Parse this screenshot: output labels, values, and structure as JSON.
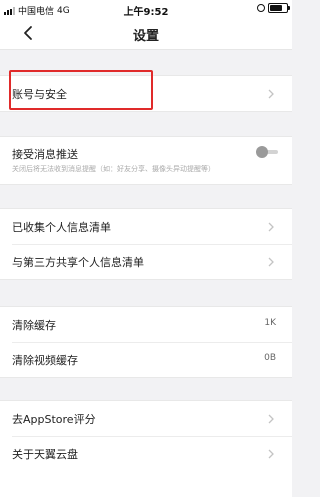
{
  "status_bar": {
    "carrier": "中国电信",
    "network": "4G",
    "time": "上午9:52",
    "battery_level": 0.85
  },
  "nav": {
    "back_icon": "chevron-left-icon",
    "title": "设置"
  },
  "sections": {
    "account": {
      "label": "账号与安全"
    },
    "push": {
      "label": "接受消息推送",
      "sublabel": "关闭后将无法收到消息提醒（如：好友分享、摄像头异动提醒等）",
      "enabled": false
    },
    "privacy": {
      "collected_label": "已收集个人信息清单",
      "shared_label": "与第三方共享个人信息清单"
    },
    "cache": {
      "clear_cache_label": "清除缓存",
      "clear_cache_value": "1K",
      "clear_video_label": "清除视频缓存",
      "clear_video_value": "0B"
    },
    "about": {
      "rate_label": "去AppStore评分",
      "about_label": "关于天翼云盘"
    }
  },
  "colors": {
    "highlight": "#e02a2a",
    "background": "#f2f2f4"
  }
}
